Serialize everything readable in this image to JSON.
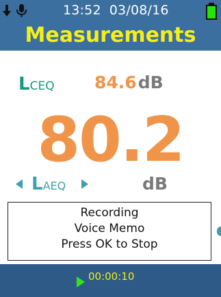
{
  "status_bar": {
    "time": "13:52",
    "date": "03/08/16",
    "icons": [
      "download-arrow-icon",
      "microphone-icon",
      "battery-icon"
    ]
  },
  "header": {
    "title": "Measurements"
  },
  "secondary_measure": {
    "label_main": "L",
    "label_sub": "CEQ",
    "value": "84.6",
    "unit": "dB"
  },
  "primary_measure": {
    "value": "80.2",
    "label_main": "L",
    "label_sub": "AEQ",
    "unit": "dB"
  },
  "popup": {
    "line1": "Recording",
    "line2": "Voice Memo",
    "line3": "Press OK to Stop"
  },
  "footer": {
    "timer": "00:00:10"
  },
  "colors": {
    "header_bg": "#3a6f9f",
    "title_yellow": "#f4ee1c",
    "value_orange": "#f0944a",
    "lceq_green": "#16987c",
    "laeq_teal": "#3ea0ad",
    "footer_bg": "#2d5a87",
    "battery_green": "#22e600",
    "play_green": "#2ee61a"
  }
}
